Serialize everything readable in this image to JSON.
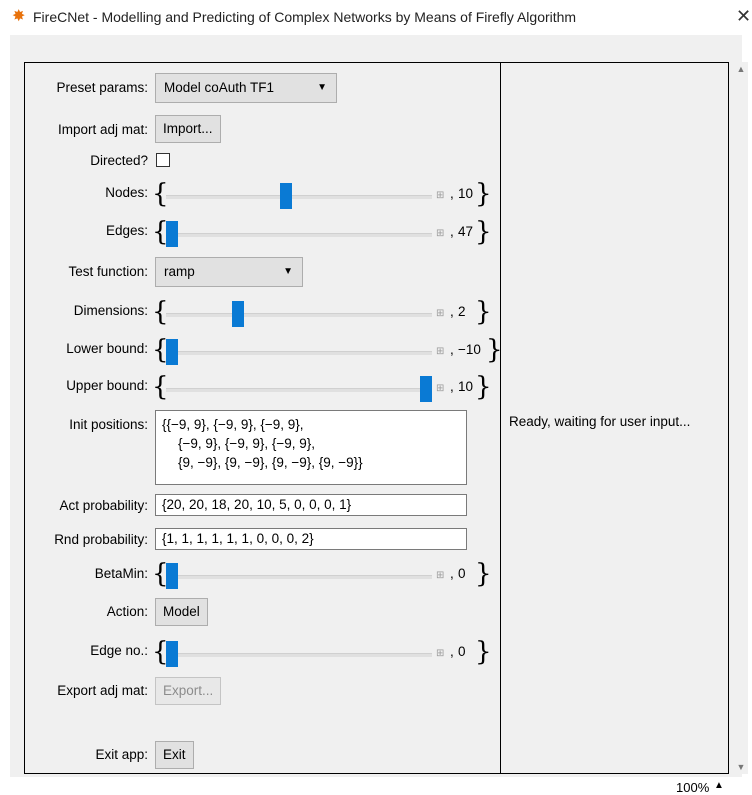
{
  "window": {
    "title": "FireCNet - Modelling and Predicting of Complex Networks by Means of Firefly Algorithm",
    "close_glyph": "✕",
    "icon_glyph": "✸"
  },
  "form": {
    "preset": {
      "label": "Preset params:",
      "value": "Model coAuth TF1"
    },
    "import": {
      "label": "Import adj mat:",
      "button": "Import..."
    },
    "directed": {
      "label": "Directed?",
      "checked": false
    },
    "nodes": {
      "label": "Nodes:",
      "value_text": "10",
      "level": 0.45
    },
    "edges": {
      "label": "Edges:",
      "value_text": "47",
      "level": 0.0
    },
    "test_function": {
      "label": "Test function:",
      "value": "ramp"
    },
    "dimensions": {
      "label": "Dimensions:",
      "value_text": "2",
      "level": 0.26
    },
    "lower_bound": {
      "label": "Lower bound:",
      "value_text": "−10",
      "level": 0.0
    },
    "upper_bound": {
      "label": "Upper bound:",
      "value_text": "10",
      "level": 1.0
    },
    "init_positions": {
      "label": "Init positions:",
      "lines": [
        "{{−9, 9}, {−9, 9}, {−9, 9},",
        "{−9, 9}, {−9, 9}, {−9, 9},",
        "{9, −9}, {9, −9}, {9, −9}, {9, −9}}"
      ]
    },
    "act_probability": {
      "label": "Act probability:",
      "value": "{20, 20, 18, 20, 10, 5, 0, 0, 0, 1}"
    },
    "rnd_probability": {
      "label": "Rnd probability:",
      "value": "{1, 1, 1, 1, 1, 1, 0, 0, 0, 2}"
    },
    "beta_min": {
      "label": "BetaMin:",
      "value_text": "0",
      "level": 0.0
    },
    "action": {
      "label": "Action:",
      "button": "Model"
    },
    "edge_no": {
      "label": "Edge no.:",
      "value_text": "0",
      "level": 0.0
    },
    "export": {
      "label": "Export adj mat:",
      "button": "Export..."
    },
    "exit": {
      "label": "Exit app:",
      "button": "Exit"
    }
  },
  "status": {
    "text": "Ready, waiting for user input..."
  },
  "footer": {
    "zoom": "100%",
    "zoom_arrow": "▲"
  },
  "glyphs": {
    "brace_open": "{",
    "brace_close": "}",
    "slider_plus": "⊞",
    "dropdown": "▼",
    "scroll_up": "▲",
    "scroll_down": "▼"
  },
  "colors": {
    "slider_thumb": "#0a7ad4",
    "icon": "#e8720c"
  }
}
